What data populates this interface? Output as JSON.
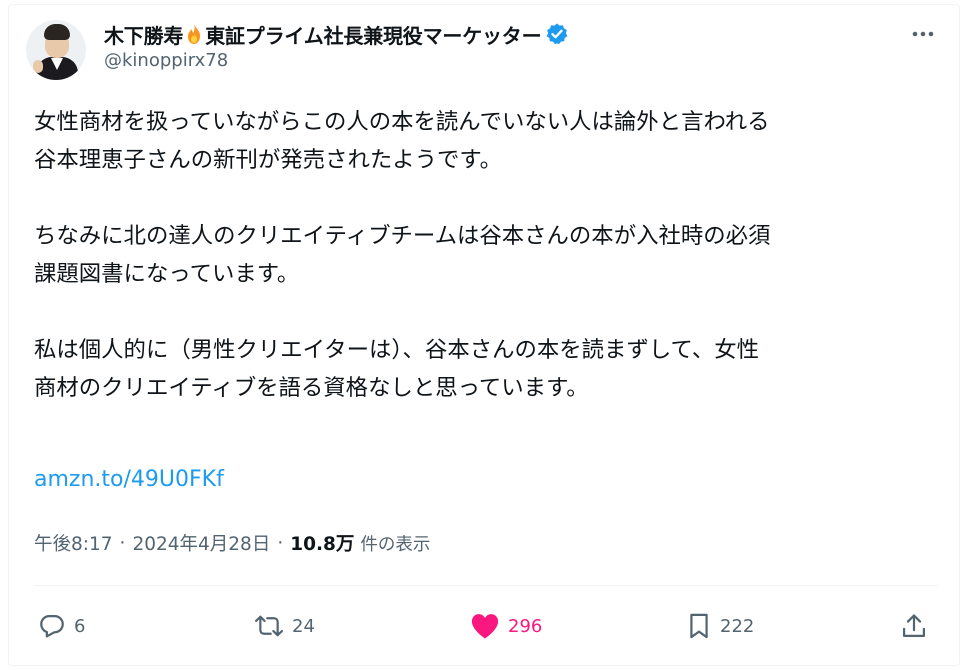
{
  "tweet": {
    "author": {
      "display_name_part1": "木下勝寿",
      "display_name_part2": "東証プライム社長兼現役マーケッター",
      "handle": "@kinoppirx78",
      "verified": true,
      "badge_icon": "verified-badge-icon",
      "emoji_icon": "fire-icon"
    },
    "body": "女性商材を扱っていながらこの人の本を読んでいない人は論外と言われる\n谷本理恵子さんの新刊が発売されたようです。\n\nちなみに北の達人のクリエイティブチームは谷本さんの本が入社時の必須\n課題図書になっています。\n\n私は個人的に（男性クリエイターは）、谷本さんの本を読まずして、女性\n商材のクリエイティブを語る資格なしと思っています。",
    "link": "amzn.to/49U0FKf",
    "meta": {
      "time": "午後8:17",
      "date": "2024年4月28日",
      "separator": "·",
      "views_count": "10.8万",
      "views_label": "件の表示"
    },
    "actions": {
      "reply_count": "6",
      "retweet_count": "24",
      "like_count": "296",
      "bookmark_count": "222"
    }
  },
  "colors": {
    "text": "#0f1419",
    "secondary": "#536471",
    "link": "#1d9bf0",
    "like": "#f91880",
    "verified": "#1d9bf0",
    "divider": "#eff3f4"
  }
}
